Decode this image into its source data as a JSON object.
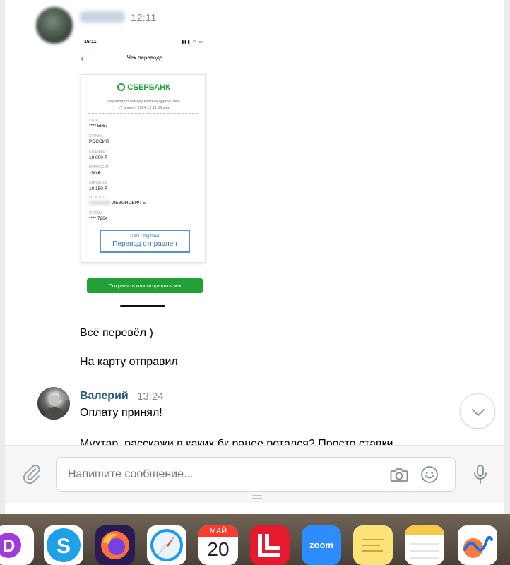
{
  "chat": {
    "first_message_time": "12:11",
    "messages": [
      {
        "text": "Всё перевёл )"
      },
      {
        "text": "На карту отправил"
      }
    ],
    "second_sender": {
      "name": "Валерий",
      "time": "13:24",
      "messages": [
        {
          "text": "Оплату принял!"
        },
        {
          "text": "Мухтар, расскажи в каких бк ранее ротался? Просто ставки"
        }
      ]
    }
  },
  "receipt_screenshot": {
    "status_time": "16:11",
    "status_icons": "▮▮▮ ◠ ▭",
    "back_icon": "chevron-left-icon",
    "screen_title": "Чек перевода",
    "bank_name": "СБЕРБАНК",
    "subtitle_line1": "Перевод по номеру карты в другой банк",
    "subtitle_line2": "17 апреля 2024 12:11:06 мск",
    "fields": [
      {
        "label": "КУДА",
        "value": "**** 5967"
      },
      {
        "label": "СТРАНА",
        "value": "РОССИЯ"
      },
      {
        "label": "СКОЛЬКО",
        "value": "10 000 ₽"
      },
      {
        "label": "КОМИССИЯ",
        "value": "150 ₽"
      },
      {
        "label": "СПИСАНО",
        "value": "10 150 ₽"
      },
      {
        "label": "ОТ КОГО",
        "value": "ЛЕВОНОВИЧ Е."
      },
      {
        "label": "ОТКУДА",
        "value": "**** 7264"
      }
    ],
    "status_small": "ПАО Сбербанк",
    "status_big": "Перевод отправлен",
    "save_button": "Сохранить или отправить чек",
    "brand_color": "#21a038"
  },
  "composer": {
    "placeholder": "Напишите сообщение...",
    "attach_icon": "paperclip-icon",
    "camera_icon": "camera-icon",
    "emoji_icon": "smile-icon",
    "mic_icon": "microphone-icon"
  },
  "scroll_down_icon": "chevron-down-icon",
  "dock": {
    "calendar_month": "МАЙ",
    "calendar_day": "20",
    "zoom_label": "zoom",
    "apps": [
      "app-d",
      "skype",
      "firefox",
      "safari",
      "calendar",
      "app-l",
      "zoom",
      "stickies",
      "notes",
      "freeform"
    ]
  }
}
